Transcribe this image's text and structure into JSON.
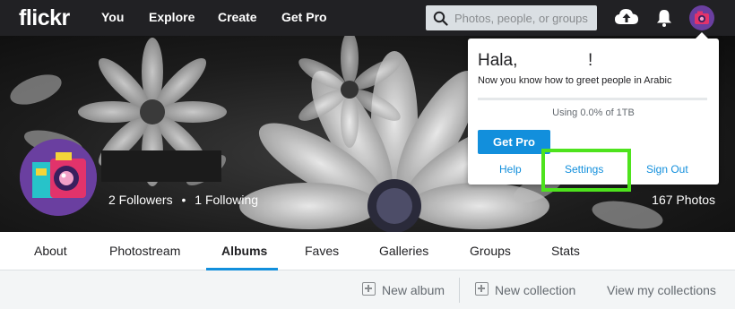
{
  "topbar": {
    "logo": "flickr",
    "nav": [
      "You",
      "Explore",
      "Create",
      "Get Pro"
    ],
    "search_placeholder": "Photos, people, or groups",
    "upload_icon": "cloud-upload-icon",
    "notifications_icon": "bell-icon"
  },
  "profile": {
    "followers": "2 Followers",
    "following": "1 Following",
    "separator": "•",
    "photos": "167 Photos"
  },
  "tabs": {
    "items": [
      "About",
      "Photostream",
      "Albums",
      "Faves",
      "Galleries",
      "Groups",
      "Stats"
    ],
    "active": "Albums"
  },
  "actions": {
    "new_album": "New album",
    "new_collection": "New collection",
    "view_collections": "View my collections"
  },
  "dropdown": {
    "greeting": "Hala,",
    "exclaim": "!",
    "subtitle": "Now you know how to greet people in Arabic",
    "quota_text": "Using 0.0% of 1TB",
    "quota_fraction": 0.0,
    "get_pro": "Get Pro",
    "help": "Help",
    "settings": "Settings",
    "sign_out": "Sign Out"
  },
  "colors": {
    "topbar": "#212124",
    "accent": "#128fdc",
    "highlight": "#4ee31d"
  }
}
